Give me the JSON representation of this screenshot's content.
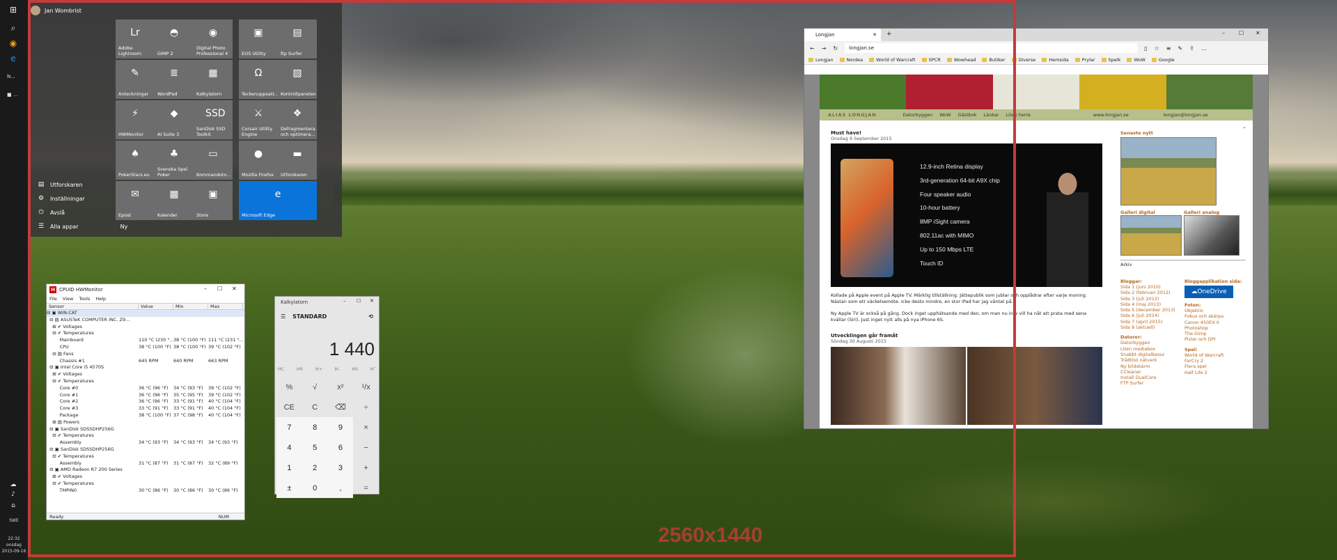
{
  "desktop": {
    "overlay_label": "2560x1440"
  },
  "taskbar": {
    "items": [
      "N...",
      "■ ..."
    ],
    "clock": {
      "time": "22:32",
      "day": "onsdag",
      "date": "2015-09-16"
    },
    "tray_label": "SWE"
  },
  "start_menu": {
    "user": "Jan Wombrist",
    "list": [
      {
        "label": "Utforskaren",
        "icon": "folder-icon",
        "arrow": "›"
      },
      {
        "label": "Inställningar",
        "icon": "gear-icon"
      },
      {
        "label": "Avslå",
        "icon": "power-icon"
      },
      {
        "label": "Alla appar",
        "icon": "apps-icon",
        "extra": "Ny"
      }
    ],
    "tiles": [
      {
        "label": "Adobe Lightroom",
        "glyph": "Lr",
        "color": "#6d6d6d"
      },
      {
        "label": "GIMP 2",
        "glyph": "◓",
        "color": "#6d6d6d"
      },
      {
        "label": "Digital Photo Professional 4",
        "glyph": "◉",
        "color": "#6d6d6d"
      },
      {
        "label": "EOS Utility",
        "glyph": "▣",
        "color": "#6d6d6d"
      },
      {
        "label": "ftp Surfer",
        "glyph": "▤",
        "color": "#6d6d6d"
      },
      {
        "label": "Anteckningar",
        "glyph": "✎",
        "color": "#6d6d6d"
      },
      {
        "label": "WordPad",
        "glyph": "≣",
        "color": "#6d6d6d"
      },
      {
        "label": "Kalkylatorn",
        "glyph": "▦",
        "color": "#6d6d6d"
      },
      {
        "label": "Teckenuppsatt...",
        "glyph": "Ω",
        "color": "#6d6d6d"
      },
      {
        "label": "Kontrollpanelen",
        "glyph": "▧",
        "color": "#6d6d6d"
      },
      {
        "label": "HWMonitor",
        "glyph": "⚡",
        "color": "#6d6d6d"
      },
      {
        "label": "AI Suite 3",
        "glyph": "◆",
        "color": "#6d6d6d"
      },
      {
        "label": "SanDisk SSD Toolkit",
        "glyph": "SSD",
        "color": "#6d6d6d"
      },
      {
        "label": "Corsair Utility Engine",
        "glyph": "⚔",
        "color": "#6d6d6d"
      },
      {
        "label": "Defragmentera och optimera...",
        "glyph": "❖",
        "color": "#6d6d6d"
      },
      {
        "label": "PokerStars.eu",
        "glyph": "♠",
        "color": "#6d6d6d"
      },
      {
        "label": "Svenska Spel Poker",
        "glyph": "♣",
        "color": "#6d6d6d"
      },
      {
        "label": "Kommandoto...",
        "glyph": "▭",
        "color": "#6d6d6d"
      },
      {
        "label": "Mozilla Firefox",
        "glyph": "●",
        "color": "#6d6d6d"
      },
      {
        "label": "Utforskaren",
        "glyph": "▬",
        "color": "#6d6d6d"
      },
      {
        "label": "Epost",
        "glyph": "✉",
        "color": "#6d6d6d"
      },
      {
        "label": "Kalender",
        "glyph": "▦",
        "color": "#6d6d6d"
      },
      {
        "label": "Store",
        "glyph": "▣",
        "color": "#6d6d6d"
      },
      {
        "label": "Microsoft Edge",
        "glyph": "e",
        "color": "#0a74da"
      }
    ]
  },
  "hwmonitor": {
    "title": "CPUID HWMonitor",
    "menu": [
      "File",
      "View",
      "Tools",
      "Help"
    ],
    "columns": [
      "Sensor",
      "Value",
      "Min",
      "Max"
    ],
    "rows": [
      [
        "⊟ ▣ WIN-CAT",
        "",
        "",
        ""
      ],
      [
        "  ⊟ ▤ ASUSTeK COMPUTER INC. Z9...",
        "",
        "",
        ""
      ],
      [
        "    ⊞ ✔ Voltages",
        "",
        "",
        ""
      ],
      [
        "    ⊟ ✔ Temperatures",
        "",
        "",
        ""
      ],
      [
        "         Mainboard",
        "110 °C (230 °...",
        "38 °C (100 °F)",
        "111 °C (231 °..."
      ],
      [
        "         CPU",
        "38 °C (100 °F)",
        "38 °C (100 °F)",
        "39 °C (102 °F)"
      ],
      [
        "    ⊟ ▤ Fans",
        "",
        "",
        ""
      ],
      [
        "         Chassis #1",
        "645 RPM",
        "640 RPM",
        "663 RPM"
      ],
      [
        "  ⊟ ▣ Intel Core i5 4570S",
        "",
        "",
        ""
      ],
      [
        "    ⊞ ✔ Voltages",
        "",
        "",
        ""
      ],
      [
        "    ⊟ ✔ Temperatures",
        "",
        "",
        ""
      ],
      [
        "         Core #0",
        "36 °C (96 °F)",
        "34 °C (93 °F)",
        "39 °C (102 °F)"
      ],
      [
        "         Core #1",
        "36 °C (96 °F)",
        "35 °C (95 °F)",
        "39 °C (102 °F)"
      ],
      [
        "         Core #2",
        "36 °C (96 °F)",
        "33 °C (91 °F)",
        "40 °C (104 °F)"
      ],
      [
        "         Core #3",
        "33 °C (91 °F)",
        "33 °C (91 °F)",
        "40 °C (104 °F)"
      ],
      [
        "         Package",
        "38 °C (100 °F)",
        "37 °C (98 °F)",
        "40 °C (104 °F)"
      ],
      [
        "    ⊞ ▤ Powers",
        "",
        "",
        ""
      ],
      [
        "  ⊟ ▣ SanDisk SDSSDHP256G",
        "",
        "",
        ""
      ],
      [
        "    ⊟ ✔ Temperatures",
        "",
        "",
        ""
      ],
      [
        "         Assembly",
        "34 °C (93 °F)",
        "34 °C (93 °F)",
        "34 °C (93 °F)"
      ],
      [
        "  ⊟ ▣ SanDisk SDSSDHP256G",
        "",
        "",
        ""
      ],
      [
        "    ⊟ ✔ Temperatures",
        "",
        "",
        ""
      ],
      [
        "         Assembly",
        "31 °C (87 °F)",
        "31 °C (87 °F)",
        "32 °C (89 °F)"
      ],
      [
        "  ⊟ ▣ AMD Radeon R7 200 Series",
        "",
        "",
        ""
      ],
      [
        "    ⊞ ✔ Voltages",
        "",
        "",
        ""
      ],
      [
        "    ⊟ ✔ Temperatures",
        "",
        "",
        ""
      ],
      [
        "         TMPIN0",
        "30 °C (86 °F)",
        "30 °C (86 °F)",
        "30 °C (86 °F)"
      ]
    ],
    "status_left": "Ready",
    "status_right": "NUM"
  },
  "calculator": {
    "title": "Kalkylatorn",
    "mode": "STANDARD",
    "display": "1 440",
    "memory": [
      "MC",
      "MR",
      "M+",
      "M-",
      "MS",
      "Mˇ"
    ],
    "keys": [
      "%",
      "√",
      "x²",
      "¹/x",
      "CE",
      "C",
      "⌫",
      "÷",
      "7",
      "8",
      "9",
      "×",
      "4",
      "5",
      "6",
      "−",
      "1",
      "2",
      "3",
      "+",
      "±",
      "0",
      ",",
      "="
    ]
  },
  "browser": {
    "tab_title": "Longjan",
    "url": "longjan.se",
    "favorites": [
      "Longjan",
      "Nordea",
      "World of Warcraft",
      "SPCR",
      "Wowhead",
      "Butiker",
      "Diverse",
      "Hemsida",
      "Prylar",
      "Spelk",
      "WoW",
      "Google"
    ],
    "site": {
      "logo": "ALIAS LONGJAN",
      "nav": [
        "Datorbyggen",
        "WoW",
        "Gästbok",
        "Länkar",
        "Liten herre"
      ],
      "nav_url": "www.longjan.se",
      "nav_mail": "longjan@longjan.se",
      "post1": {
        "title": "Must have!",
        "date": "Onsdag 9 September 2015",
        "features": [
          "12.9-inch Retina display",
          "3rd-generation 64-bit A9X chip",
          "Four speaker audio",
          "10-hour battery",
          "8MP iSight camera",
          "802.11ac with MIMO",
          "Up to 150 Mbps LTE",
          "Touch ID"
        ],
        "text1": "Kollade på Apple event på Apple TV. Märklig tillställning. Jättepublik som jublar och opplådrar efter varje moning. Nästan som ett väckelsemöte. Icke desto mindre, en stor iPad har jag väntat på.",
        "text2": "Ny Apple TV är också på gång. Dock inget upphätsande med den, om man nu inte vill ha nåt att prata med sena kvällar (Siri). Just inget nytt alls på nya iPhone 6S."
      },
      "post2": {
        "title": "Utvecklingen går framåt",
        "date": "Söndag 30 Augusti 2015"
      },
      "sidebar": {
        "newest": "Senaste nytt",
        "gallery_digital": "Galleri digital",
        "gallery_analog": "Galleri analog",
        "archive": "Arkiv",
        "blog_h": "Bloggar:",
        "blog": [
          "Sida 1 (juni 2010)",
          "Sida 2 (februari 2012)",
          "Sida 3 (juli 2012)",
          "Sida 4 (maj 2013)",
          "Sida 5 (december 2013)",
          "Sida 6 (juli 2014)",
          "Sida 7 (april 2015)",
          "Sida 8 (aktuell)"
        ],
        "data_h": "Datorer:",
        "data": [
          "Datorbyggen",
          "Liten mediabox",
          "Snabbt digitalbesur",
          "Trådlöst nätverk",
          "Ny bildskärm",
          "CCleaner",
          "Install DualCore",
          "FTP Surfer"
        ],
        "od_h": "Bloggapplikation sida:",
        "onedrive": "OneDrive",
        "foto_h": "Foton:",
        "foto": [
          "Objektiv",
          "Fokus och skärpa",
          "Canon 450EX II",
          "Photoshop",
          "The Gimp",
          "Pixlar och DPI"
        ],
        "spel_h": "Spel:",
        "spel": [
          "World of Warcraft",
          "FarCry 2",
          "Flera spel",
          "Half Life 2"
        ]
      }
    }
  }
}
